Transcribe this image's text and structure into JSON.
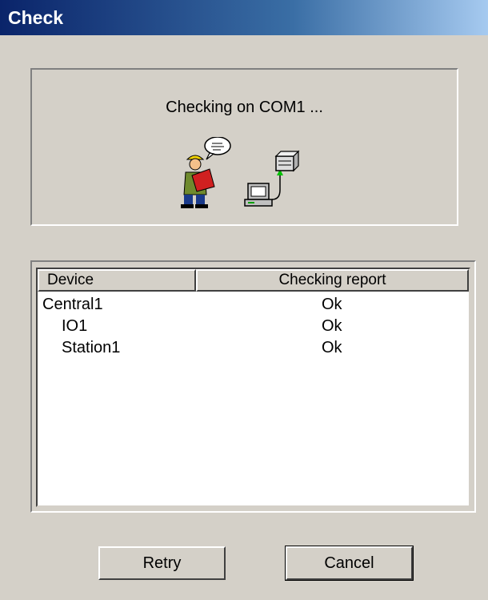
{
  "window": {
    "title": "Check"
  },
  "status": {
    "text": "Checking on COM1 ..."
  },
  "icons": {
    "worker": "worker-with-speech-bubble-icon",
    "computer": "computer-network-icon"
  },
  "list": {
    "columns": [
      "Device",
      "Checking report"
    ],
    "rows": [
      {
        "device": "Central1",
        "report": "Ok",
        "level": 0
      },
      {
        "device": "IO1",
        "report": "Ok",
        "level": 1
      },
      {
        "device": "Station1",
        "report": "Ok",
        "level": 1
      }
    ]
  },
  "buttons": {
    "retry": "Retry",
    "cancel": "Cancel"
  }
}
